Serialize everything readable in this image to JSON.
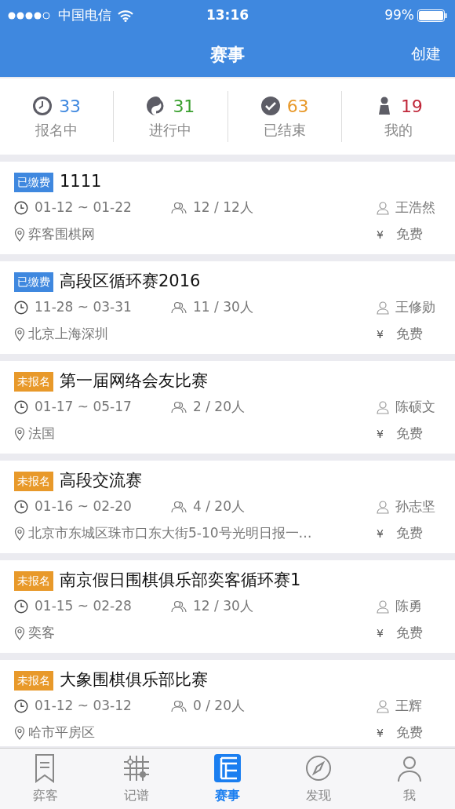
{
  "status_bar": {
    "carrier": "中国电信",
    "time": "13:16",
    "battery": "99%"
  },
  "nav": {
    "title": "赛事",
    "action": "创建"
  },
  "stats": [
    {
      "kind": "clock",
      "count": "33",
      "label": "报名中",
      "color": "#3f88df"
    },
    {
      "kind": "swirl",
      "count": "31",
      "label": "进行中",
      "color": "#3aa02f"
    },
    {
      "kind": "check",
      "count": "63",
      "label": "已结束",
      "color": "#e8992a"
    },
    {
      "kind": "person",
      "count": "19",
      "label": "我的",
      "color": "#c0283a"
    }
  ],
  "events": [
    {
      "badge": {
        "kind": "paid",
        "text": "已缴费"
      },
      "title": "1111",
      "dates": "01-12 ~ 01-22",
      "players": "12 / 12人",
      "organizer": "王浩然",
      "place": "弈客围棋网",
      "fee_symbol": "¥",
      "fee": "免费"
    },
    {
      "badge": {
        "kind": "paid",
        "text": "已缴费"
      },
      "title": "高段区循环赛2016",
      "dates": "11-28 ~ 03-31",
      "players": "11 / 30人",
      "organizer": "王修勋",
      "place": "北京上海深圳",
      "fee_symbol": "¥",
      "fee": "免费"
    },
    {
      "badge": {
        "kind": "unregistered",
        "text": "未报名"
      },
      "title": "第一届网络会友比赛",
      "dates": "01-17 ~ 05-17",
      "players": "2 / 20人",
      "organizer": "陈硕文",
      "place": "法国",
      "fee_symbol": "¥",
      "fee": "免费"
    },
    {
      "badge": {
        "kind": "unregistered",
        "text": "未报名"
      },
      "title": "高段交流赛",
      "dates": "01-16 ~ 02-20",
      "players": "4 / 20人",
      "organizer": "孙志坚",
      "place": "北京市东城区珠市口东大街5-10号光明日报一…",
      "fee_symbol": "¥",
      "fee": "免费"
    },
    {
      "badge": {
        "kind": "unregistered",
        "text": "未报名"
      },
      "title": "南京假日围棋俱乐部奕客循环赛1",
      "dates": "01-15 ~ 02-28",
      "players": "12 / 30人",
      "organizer": "陈勇",
      "place": "奕客",
      "fee_symbol": "¥",
      "fee": "免费"
    },
    {
      "badge": {
        "kind": "unregistered",
        "text": "未报名"
      },
      "title": "大象围棋俱乐部比赛",
      "dates": "01-12 ~ 03-12",
      "players": "0 / 20人",
      "organizer": "王辉",
      "place": "哈市平房区",
      "fee_symbol": "¥",
      "fee": "免费"
    }
  ],
  "tab_bar": [
    {
      "kind": "bookmark",
      "label": "弈客",
      "selected": false
    },
    {
      "kind": "grid",
      "label": "记谱",
      "selected": false
    },
    {
      "kind": "board",
      "label": "赛事",
      "selected": true
    },
    {
      "kind": "compass",
      "label": "发现",
      "selected": false
    },
    {
      "kind": "user",
      "label": "我",
      "selected": false
    }
  ]
}
